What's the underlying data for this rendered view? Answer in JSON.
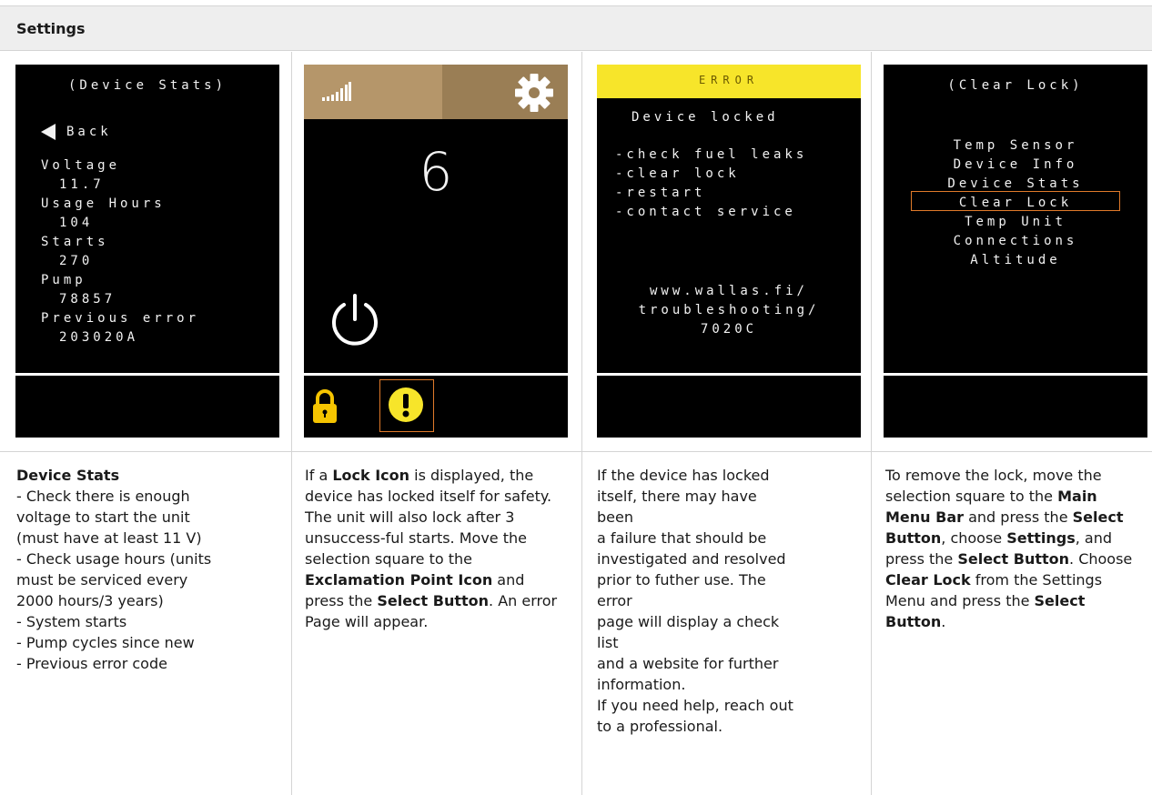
{
  "header": {
    "title": "Settings"
  },
  "screen1": {
    "title": "(Device Stats)",
    "back": "Back",
    "lines": [
      "Voltage",
      "11.7",
      "Usage Hours",
      "104",
      "Starts",
      "270",
      "Pump",
      "78857",
      "Previous error",
      "203020A"
    ]
  },
  "screen2": {
    "number": "6"
  },
  "screen3": {
    "banner": "ERROR",
    "title": "Device locked",
    "checklist": [
      "-check fuel leaks",
      "-clear lock",
      "-restart",
      "-contact service"
    ],
    "url_lines": [
      "www.wallas.fi/",
      "troubleshooting/",
      "7020C"
    ]
  },
  "screen4": {
    "title": "(Clear Lock)",
    "items": [
      "Temp Sensor",
      "Device Info",
      "Device Stats",
      "Clear Lock",
      "Temp Unit",
      "Connections",
      "Altitude"
    ]
  },
  "col1": {
    "heading": "Device Stats",
    "lines": [
      "- Check there is enough",
      "voltage to start the unit",
      "(must have at least 11 V)",
      "- Check usage hours (units",
      "must be serviced every",
      "2000 hours/3 years)",
      "- System starts",
      "- Pump cycles since new",
      "- Previous error code"
    ]
  },
  "col2": {
    "t1": "If a ",
    "b1": "Lock Icon",
    "t2": " is displayed, the device has locked itself for safety. The unit will also lock after 3 unsuccess-ful starts. Move the selection square to the ",
    "b2": "Exclamation Point Icon",
    "t3": " and press the ",
    "b3": "Select Button",
    "t4": ". An error Page will appear."
  },
  "col3": {
    "lines": [
      "If the device has locked",
      "itself, there may have",
      "been",
      "a failure that should be",
      "investigated and resolved",
      "prior to futher use. The",
      "error",
      "page will display a check",
      "list",
      "and a website for further",
      "information.",
      "If you need help, reach out",
      "to a professional."
    ]
  },
  "col4": {
    "t1": "To remove the lock, move the selection square to the ",
    "b1": "Main Menu Bar",
    "t2": " and press the ",
    "b2": "Select Button",
    "t3": ", choose ",
    "b3": "Settings",
    "t4": ", and press the ",
    "b4": "Select Button",
    "t5": ". Choose ",
    "b5": "Clear Lock",
    "t6": " from the Settings Menu and press the ",
    "b6": "Select Button",
    "t7": "."
  },
  "colors": {
    "tan": "#b5966a",
    "tan_dark": "#9a7e55",
    "yellow": "#f7e52a",
    "lock_yellow": "#f5c400",
    "select_orange": "#e07a2a"
  }
}
